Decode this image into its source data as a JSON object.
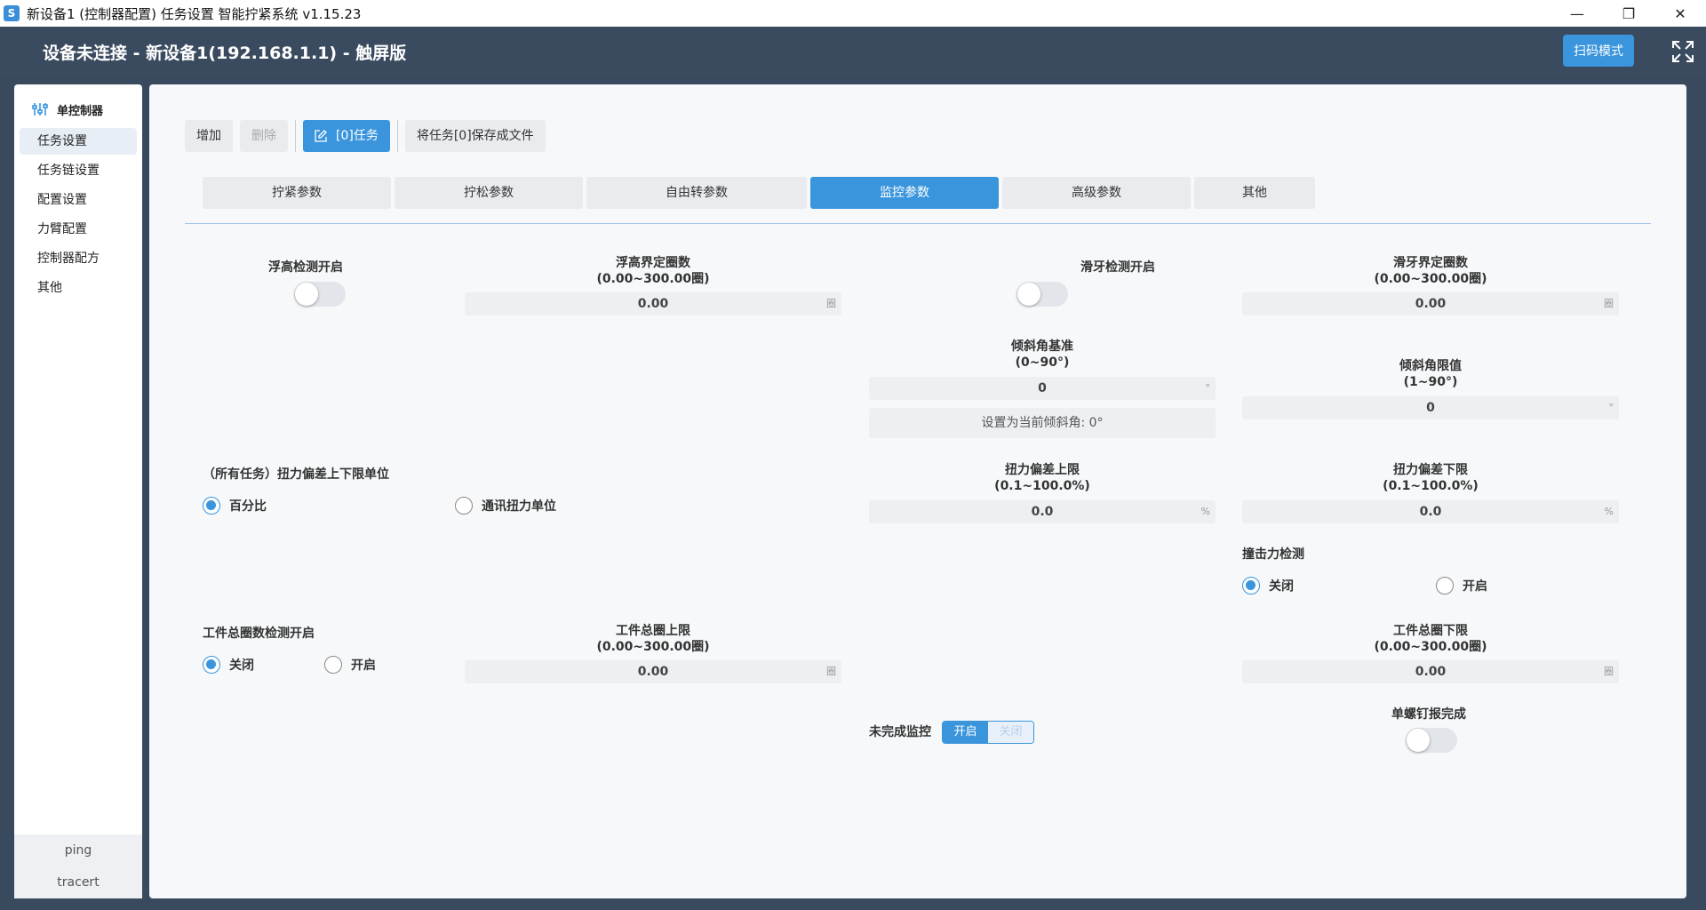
{
  "window": {
    "title": "新设备1 (控制器配置) 任务设置 智能拧紧系统 v1.15.23",
    "icon_letter": "S",
    "minimize": "—",
    "maximize": "❐",
    "close": "✕"
  },
  "header": {
    "title": "设备未连接 - 新设备1(192.168.1.1) - 触屏版",
    "scan_button": "扫码模式"
  },
  "sidebar": {
    "group_label": "单控制器",
    "items": [
      {
        "label": "任务设置",
        "active": true
      },
      {
        "label": "任务链设置"
      },
      {
        "label": "配置设置"
      },
      {
        "label": "力臂配置"
      },
      {
        "label": "控制器配方"
      },
      {
        "label": "其他"
      }
    ],
    "bottom": [
      "ping",
      "tracert"
    ]
  },
  "toolbar": {
    "add": "增加",
    "delete": "删除",
    "task": "[0]任务",
    "save": "将任务[0]保存成文件"
  },
  "tabs": [
    "拧紧参数",
    "拧松参数",
    "自由转参数",
    "监控参数",
    "高级参数",
    "其他"
  ],
  "active_tab": "监控参数",
  "form": {
    "float_detect_label": "浮高检测开启",
    "float_detect_on": false,
    "float_turns_label1": "浮高界定圈数",
    "float_turns_label2": "(0.00~300.00圈)",
    "float_turns_value": "0.00",
    "float_turns_unit": "圈",
    "slip_detect_label": "滑牙检测开启",
    "slip_detect_on": false,
    "slip_turns_label1": "滑牙界定圈数",
    "slip_turns_label2": "(0.00~300.00圈)",
    "slip_turns_value": "0.00",
    "slip_turns_unit": "圈",
    "tilt_base_label1": "倾斜角基准",
    "tilt_base_label2": "(0~90°)",
    "tilt_base_value": "0",
    "tilt_base_unit": "°",
    "set_tilt_button": "设置为当前倾斜角: 0°",
    "tilt_limit_label1": "倾斜角限值",
    "tilt_limit_label2": "(1~90°)",
    "tilt_limit_value": "0",
    "tilt_limit_unit": "°",
    "torque_unit_label": "（所有任务）扭力偏差上下限单位",
    "torque_unit_opt1": "百分比",
    "torque_unit_opt2": "通讯扭力单位",
    "torque_upper_label1": "扭力偏差上限",
    "torque_upper_label2": "(0.1~100.0%)",
    "torque_upper_value": "0.0",
    "torque_upper_unit": "%",
    "torque_lower_label1": "扭力偏差下限",
    "torque_lower_label2": "(0.1~100.0%)",
    "torque_lower_value": "0.0",
    "torque_lower_unit": "%",
    "impact_label": "撞击力检测",
    "impact_off": "关闭",
    "impact_on": "开启",
    "workpiece_detect_label": "工件总圈数检测开启",
    "workpiece_off": "关闭",
    "workpiece_on": "开启",
    "wp_upper_label1": "工件总圈上限",
    "wp_upper_label2": "(0.00~300.00圈)",
    "wp_upper_value": "0.00",
    "wp_upper_unit": "圈",
    "wp_lower_label1": "工件总圈下限",
    "wp_lower_label2": "(0.00~300.00圈)",
    "wp_lower_value": "0.00",
    "wp_lower_unit": "圈",
    "incomplete_label": "未完成监控",
    "incomplete_on": "开启",
    "incomplete_off": "关闭",
    "single_screw_label": "单螺钉报完成",
    "single_screw_on": false
  },
  "colors": {
    "accent": "#3a95dc",
    "header_bg": "#3b4b5f",
    "panel_bg": "#f6f8fa"
  }
}
